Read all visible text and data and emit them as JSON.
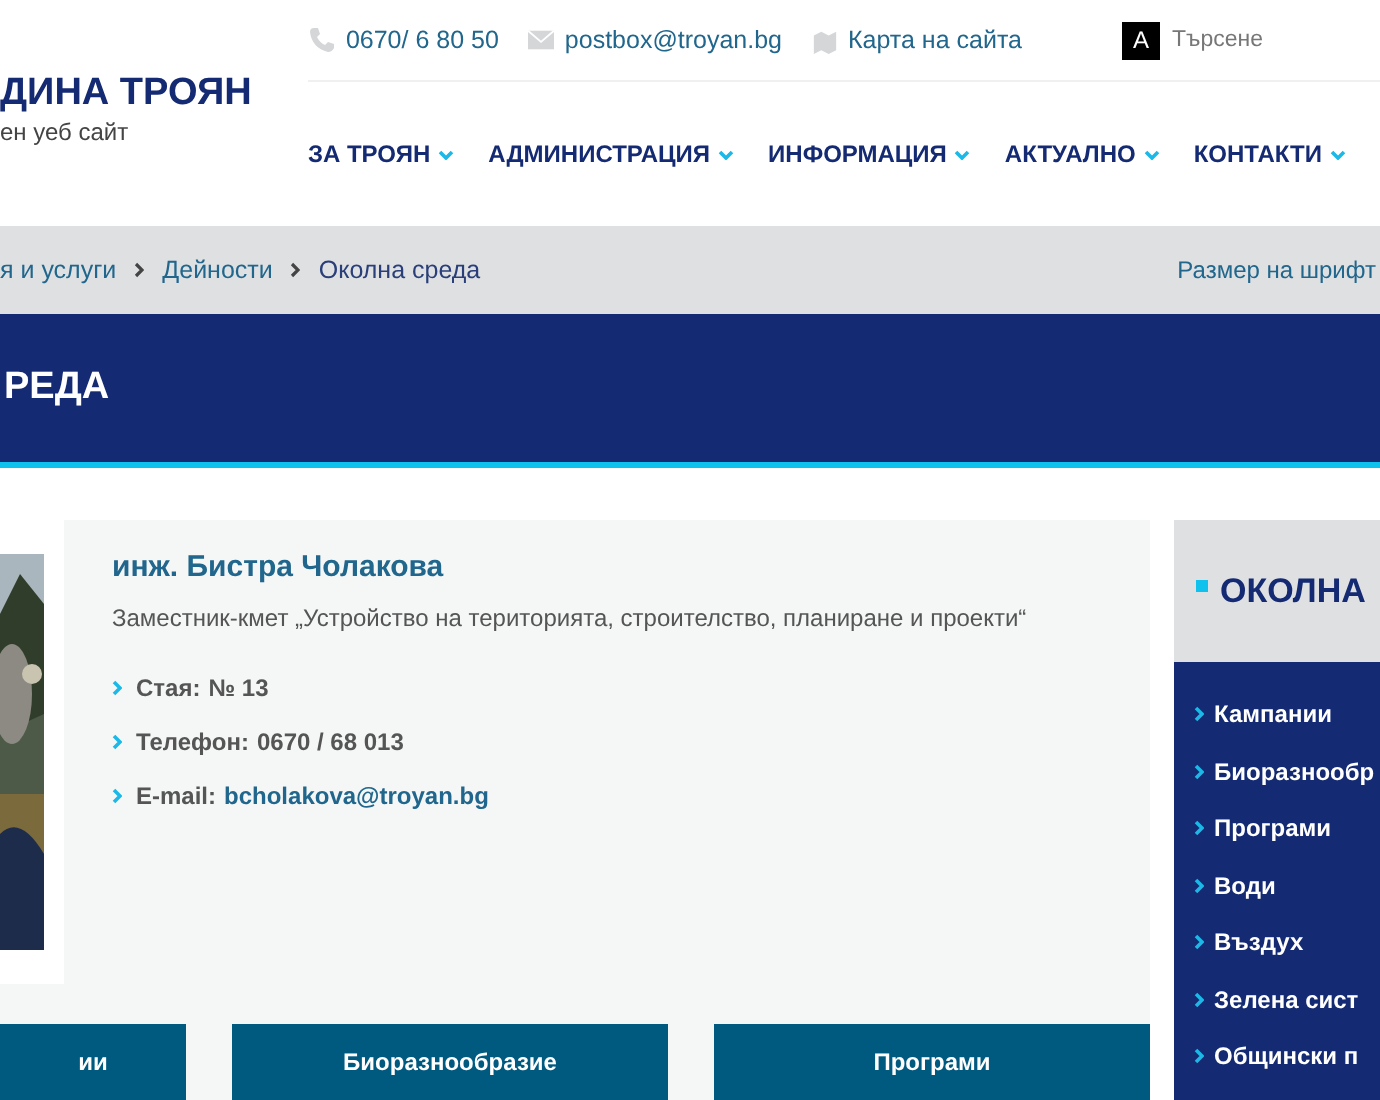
{
  "logo": {
    "title": "ДИНА ТРОЯН",
    "subtitle": "ен уеб сайт"
  },
  "top_bar": {
    "phone": "0670/ 6 80 50",
    "email": "postbox@troyan.bg",
    "sitemap": "Карта на сайта",
    "contrast_toggle": "A",
    "search": {
      "placeholder": "Търсене"
    }
  },
  "nav": [
    {
      "label": "ЗА ТРОЯН"
    },
    {
      "label": "АДМИНИСТРАЦИЯ"
    },
    {
      "label": "ИНФОРМАЦИЯ"
    },
    {
      "label": "АКТУАЛНО"
    },
    {
      "label": "КОНТАКТИ"
    }
  ],
  "breadcrumb": [
    {
      "label": "я и услуги",
      "current": false
    },
    {
      "label": "Дейности",
      "current": false
    },
    {
      "label": "Околна среда",
      "current": true
    }
  ],
  "font_size_label": "Размер на шрифт",
  "page_title": "РЕДА",
  "person": {
    "name": "инж. Бистра Чолакова",
    "position": "Заместник-кмет „Устройство на територията, строителство, планиране и проекти“",
    "details": [
      {
        "kind": "text",
        "label": "Стая:",
        "value": "№ 13"
      },
      {
        "kind": "text",
        "label": "Телефон:",
        "value": "0670 / 68 013"
      },
      {
        "kind": "link",
        "label": "E-mail:",
        "value": "bcholakova@troyan.bg"
      }
    ]
  },
  "tiles": [
    "ии",
    "Биоразнообразие",
    "Програми"
  ],
  "sidebar": {
    "title": "ОКОЛНА",
    "items": [
      "Кампании",
      "Биоразнообр",
      "Програми",
      "Води",
      "Въздух",
      "Зелена сист",
      "Общински п"
    ]
  }
}
